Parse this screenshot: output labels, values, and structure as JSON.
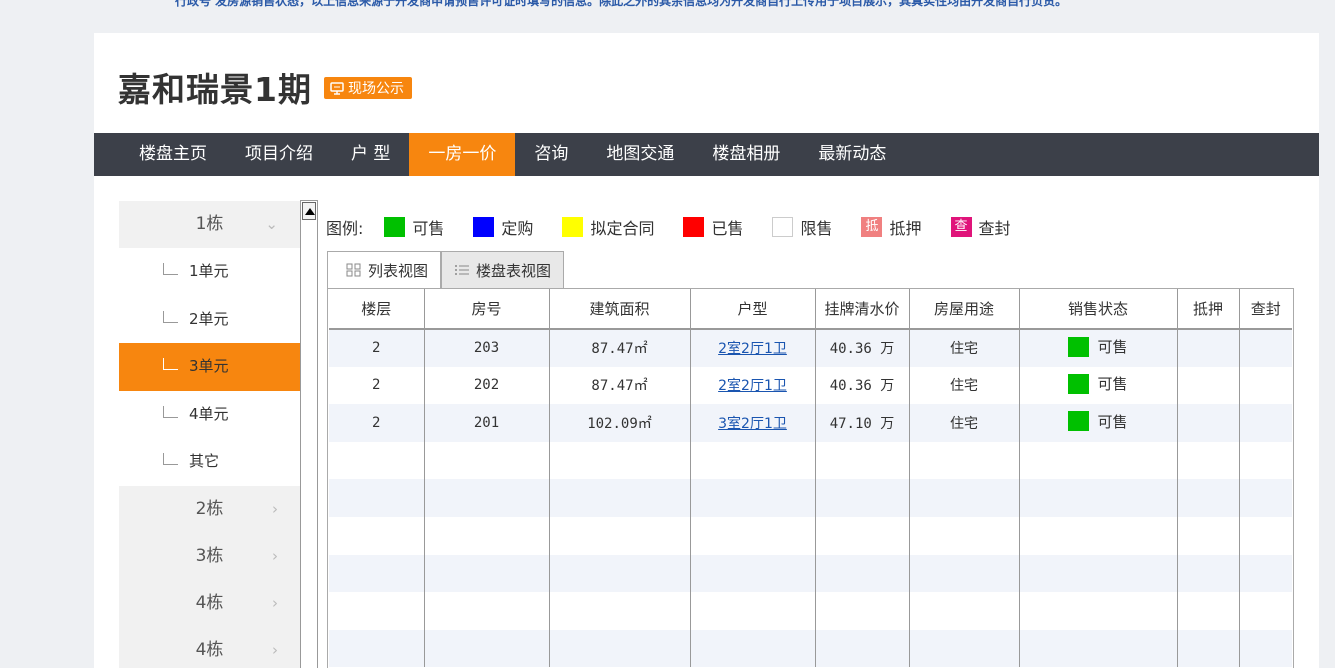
{
  "top_note": "行政号 发房源销售状态，以上信息来源于开发商申请预售许可证时填写的信息。除此之外的其余信息均为开发商自行上传用于项目展示，其真实性均由开发商自行负责。",
  "project": {
    "title": "嘉和瑞景1期",
    "badge": "现场公示"
  },
  "nav": {
    "items": [
      "楼盘主页",
      "项目介绍",
      "户 型",
      "一房一价",
      "咨询",
      "地图交通",
      "楼盘相册",
      "最新动态"
    ],
    "active_index": 3
  },
  "sidebar": {
    "expanded_building": "1栋",
    "units": [
      "1单元",
      "2单元",
      "3单元",
      "4单元",
      "其它"
    ],
    "active_unit_index": 2,
    "other_buildings": [
      "2栋",
      "3栋",
      "4栋",
      "4栋"
    ]
  },
  "legend": {
    "label": "图例:",
    "items": [
      {
        "label": "可售",
        "color": "#00c000"
      },
      {
        "label": "定购",
        "color": "#0000ff"
      },
      {
        "label": "拟定合同",
        "color": "#ffff00"
      },
      {
        "label": "已售",
        "color": "#ff0000"
      },
      {
        "label": "限售",
        "color": "#ffffff"
      },
      {
        "label": "抵押",
        "color": "#f08080",
        "char": "抵"
      },
      {
        "label": "查封",
        "color": "#e0147a",
        "char": "查"
      }
    ]
  },
  "tabs": [
    "列表视图",
    "楼盘表视图"
  ],
  "table": {
    "headers": [
      "楼层",
      "房号",
      "建筑面积",
      "户型",
      "挂牌清水价",
      "房屋用途",
      "销售状态",
      "抵押",
      "查封"
    ],
    "rows": [
      {
        "floor": "2",
        "room": "203",
        "area": "87.47㎡",
        "layout": "2室2厅1卫",
        "price": "40.36 万",
        "use": "住宅",
        "status": "可售",
        "status_color": "#00c000",
        "mortgage": "",
        "seized": ""
      },
      {
        "floor": "2",
        "room": "202",
        "area": "87.47㎡",
        "layout": "2室2厅1卫",
        "price": "40.36 万",
        "use": "住宅",
        "status": "可售",
        "status_color": "#00c000",
        "mortgage": "",
        "seized": ""
      },
      {
        "floor": "2",
        "room": "201",
        "area": "102.09㎡",
        "layout": "3室2厅1卫",
        "price": "47.10 万",
        "use": "住宅",
        "status": "可售",
        "status_color": "#00c000",
        "mortgage": "",
        "seized": ""
      }
    ]
  }
}
